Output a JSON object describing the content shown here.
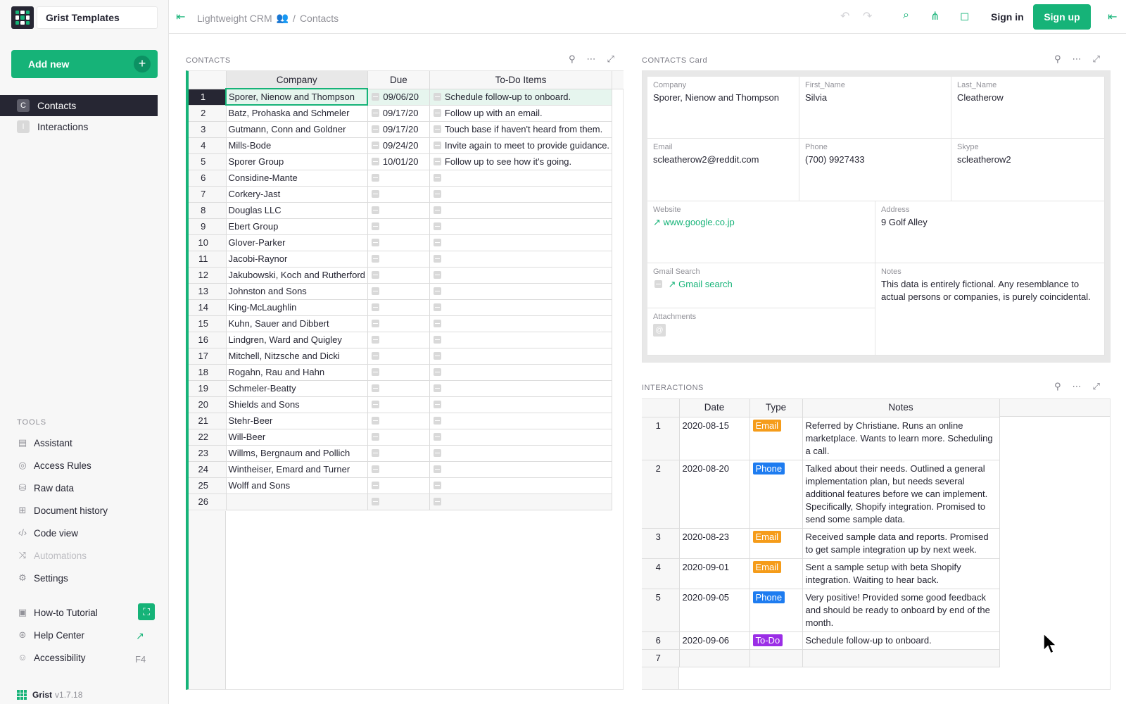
{
  "site": {
    "name": "Grist Templates"
  },
  "sidebar": {
    "add_new": "Add new",
    "pages": [
      {
        "initial": "C",
        "label": "Contacts"
      },
      {
        "initial": "I",
        "label": "Interactions"
      }
    ],
    "tools_title": "TOOLS",
    "tools": [
      {
        "icon": "assistant-icon",
        "label": "Assistant"
      },
      {
        "icon": "eye-icon",
        "label": "Access Rules"
      },
      {
        "icon": "database-icon",
        "label": "Raw data"
      },
      {
        "icon": "history-icon",
        "label": "Document history"
      },
      {
        "icon": "code-icon",
        "label": "Code view"
      },
      {
        "icon": "automations-icon",
        "label": "Automations"
      },
      {
        "icon": "gear-icon",
        "label": "Settings"
      }
    ],
    "help": [
      {
        "icon": "tutorial-icon",
        "label": "How-to Tutorial"
      },
      {
        "icon": "lifebuoy-icon",
        "label": "Help Center"
      },
      {
        "icon": "accessibility-icon",
        "label": "Accessibility",
        "shortcut": "F4"
      }
    ],
    "version_name": "Grist",
    "version_num": "v1.7.18"
  },
  "topbar": {
    "doc_name": "Lightweight CRM",
    "separator": "/",
    "page_name": "Contacts",
    "sign_in": "Sign in",
    "sign_up": "Sign up"
  },
  "contacts": {
    "title": "CONTACTS",
    "columns": [
      "Company",
      "Due",
      "To-Do Items"
    ],
    "rows": [
      {
        "n": "1",
        "company": "Sporer, Nienow and Thompson",
        "due": "09/06/20",
        "todo": "Schedule follow-up to onboard."
      },
      {
        "n": "2",
        "company": "Batz, Prohaska and Schmeler",
        "due": "09/17/20",
        "todo": "Follow up with an email."
      },
      {
        "n": "3",
        "company": "Gutmann, Conn and Goldner",
        "due": "09/17/20",
        "todo": "Touch base if haven't heard from them."
      },
      {
        "n": "4",
        "company": "Mills-Bode",
        "due": "09/24/20",
        "todo": "Invite again to meet to provide guidance."
      },
      {
        "n": "5",
        "company": "Sporer Group",
        "due": "10/01/20",
        "todo": "Follow up to see how it's going."
      },
      {
        "n": "6",
        "company": "Considine-Mante",
        "due": "",
        "todo": ""
      },
      {
        "n": "7",
        "company": "Corkery-Jast",
        "due": "",
        "todo": ""
      },
      {
        "n": "8",
        "company": "Douglas LLC",
        "due": "",
        "todo": ""
      },
      {
        "n": "9",
        "company": "Ebert Group",
        "due": "",
        "todo": ""
      },
      {
        "n": "10",
        "company": "Glover-Parker",
        "due": "",
        "todo": ""
      },
      {
        "n": "11",
        "company": "Jacobi-Raynor",
        "due": "",
        "todo": ""
      },
      {
        "n": "12",
        "company": "Jakubowski, Koch and Rutherford",
        "due": "",
        "todo": ""
      },
      {
        "n": "13",
        "company": "Johnston and Sons",
        "due": "",
        "todo": ""
      },
      {
        "n": "14",
        "company": "King-McLaughlin",
        "due": "",
        "todo": ""
      },
      {
        "n": "15",
        "company": "Kuhn, Sauer and Dibbert",
        "due": "",
        "todo": ""
      },
      {
        "n": "16",
        "company": "Lindgren, Ward and Quigley",
        "due": "",
        "todo": ""
      },
      {
        "n": "17",
        "company": "Mitchell, Nitzsche and Dicki",
        "due": "",
        "todo": ""
      },
      {
        "n": "18",
        "company": "Rogahn, Rau and Hahn",
        "due": "",
        "todo": ""
      },
      {
        "n": "19",
        "company": "Schmeler-Beatty",
        "due": "",
        "todo": ""
      },
      {
        "n": "20",
        "company": "Shields and Sons",
        "due": "",
        "todo": ""
      },
      {
        "n": "21",
        "company": "Stehr-Beer",
        "due": "",
        "todo": ""
      },
      {
        "n": "22",
        "company": "Will-Beer",
        "due": "",
        "todo": ""
      },
      {
        "n": "23",
        "company": "Willms, Bergnaum and Pollich",
        "due": "",
        "todo": ""
      },
      {
        "n": "24",
        "company": "Wintheiser, Emard and Turner",
        "due": "",
        "todo": ""
      },
      {
        "n": "25",
        "company": "Wolff and Sons",
        "due": "",
        "todo": ""
      },
      {
        "n": "26",
        "company": "",
        "due": "",
        "todo": ""
      }
    ]
  },
  "card": {
    "title": "CONTACTS Card",
    "fields": {
      "company": {
        "label": "Company",
        "value": "Sporer, Nienow and Thompson"
      },
      "first_name": {
        "label": "First_Name",
        "value": "Silvia"
      },
      "last_name": {
        "label": "Last_Name",
        "value": "Cleatherow"
      },
      "email": {
        "label": "Email",
        "value": "scleatherow2@reddit.com"
      },
      "phone": {
        "label": "Phone",
        "value": "(700) 9927433"
      },
      "skype": {
        "label": "Skype",
        "value": "scleatherow2"
      },
      "website": {
        "label": "Website",
        "value": "www.google.co.jp"
      },
      "address": {
        "label": "Address",
        "value": "9 Golf Alley"
      },
      "gmail": {
        "label": "Gmail Search",
        "value": "Gmail search"
      },
      "notes": {
        "label": "Notes",
        "value": "This data is entirely fictional. Any resemblance to actual persons or companies, is purely coincidental."
      },
      "attachments": {
        "label": "Attachments"
      }
    }
  },
  "interactions": {
    "title": "INTERACTIONS",
    "columns": [
      "Date",
      "Type",
      "Notes"
    ],
    "type_colors": {
      "Email": "#f59c1a",
      "Phone": "#1e7cf0",
      "To-Do": "#9b2ee6"
    },
    "rows": [
      {
        "n": "1",
        "date": "2020-08-15",
        "type": "Email",
        "notes": "Referred by Christiane. Runs an online marketplace. Wants to learn more. Scheduling a call."
      },
      {
        "n": "2",
        "date": "2020-08-20",
        "type": "Phone",
        "notes": "Talked about their needs. Outlined a general implementation plan, but needs several additional features before we can implement. Specifically, Shopify integration. Promised to send some sample data."
      },
      {
        "n": "3",
        "date": "2020-08-23",
        "type": "Email",
        "notes": "Received sample data and reports. Promised to get sample integration up by next week."
      },
      {
        "n": "4",
        "date": "2020-09-01",
        "type": "Email",
        "notes": "Sent a sample setup with beta Shopify integration. Waiting to hear back."
      },
      {
        "n": "5",
        "date": "2020-09-05",
        "type": "Phone",
        "notes": "Very positive! Provided some good feedback and should be ready to onboard by end of the month."
      },
      {
        "n": "6",
        "date": "2020-09-06",
        "type": "To-Do",
        "notes": "Schedule follow-up to onboard."
      },
      {
        "n": "7",
        "date": "",
        "type": "",
        "notes": ""
      }
    ]
  },
  "colors": {
    "accent": "#16b378",
    "dark": "#262633"
  }
}
